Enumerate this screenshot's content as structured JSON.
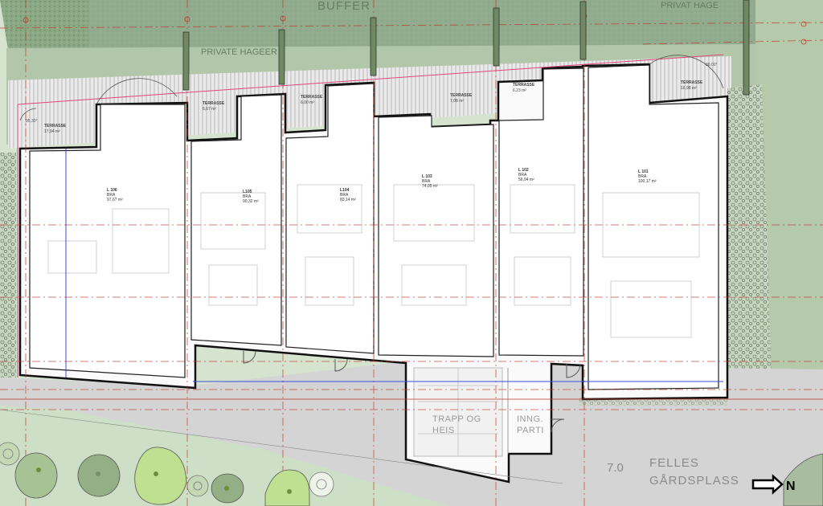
{
  "labels": {
    "buffer": "BUFFER",
    "private_hageer": "PRIVATE HAGEER",
    "privat_hage": "PRIVAT HAGE",
    "trapp": "TRAPP OG",
    "heis": "HEIS",
    "inng": "INNG.",
    "parti": "PARTI",
    "elev": "7.0",
    "felles": "FELLES",
    "gardsplass": "GÅRDSPLASS",
    "north": "N"
  },
  "angles": {
    "left": "95,30°",
    "right": "80,00°"
  },
  "terraces": [
    {
      "name": "TERRASSE",
      "area": "17,94 m²"
    },
    {
      "name": "TERRASSE",
      "area": "6,67 m²"
    },
    {
      "name": "TERRASSE",
      "area": "6,00 m²"
    },
    {
      "name": "TERRASSE",
      "area": "7,08 m²"
    },
    {
      "name": "TERRASSE",
      "area": "6,23 m²"
    },
    {
      "name": "TERRASSE",
      "area": "16,98 m²"
    }
  ],
  "units": [
    {
      "id": "L 106",
      "type": "BRA",
      "area": "97,67 m²"
    },
    {
      "id": "L105",
      "type": "BRA",
      "area": "90,32 m²"
    },
    {
      "id": "L104",
      "type": "BRA",
      "area": "83,14 m²"
    },
    {
      "id": "L 103",
      "type": "BRA",
      "area": "74,05 m²"
    },
    {
      "id": "L 102",
      "type": "BRA",
      "area": "56,04 m²"
    },
    {
      "id": "L 101",
      "type": "BRA",
      "area": "100,17 m²"
    }
  ],
  "colors": {
    "buffer": "#93ad8f",
    "garden": "#b9cdb1",
    "lawn": "#cfe0c9",
    "paving": "#d6d6d6",
    "grid": "#c0392b",
    "accent": "#e0457b"
  }
}
